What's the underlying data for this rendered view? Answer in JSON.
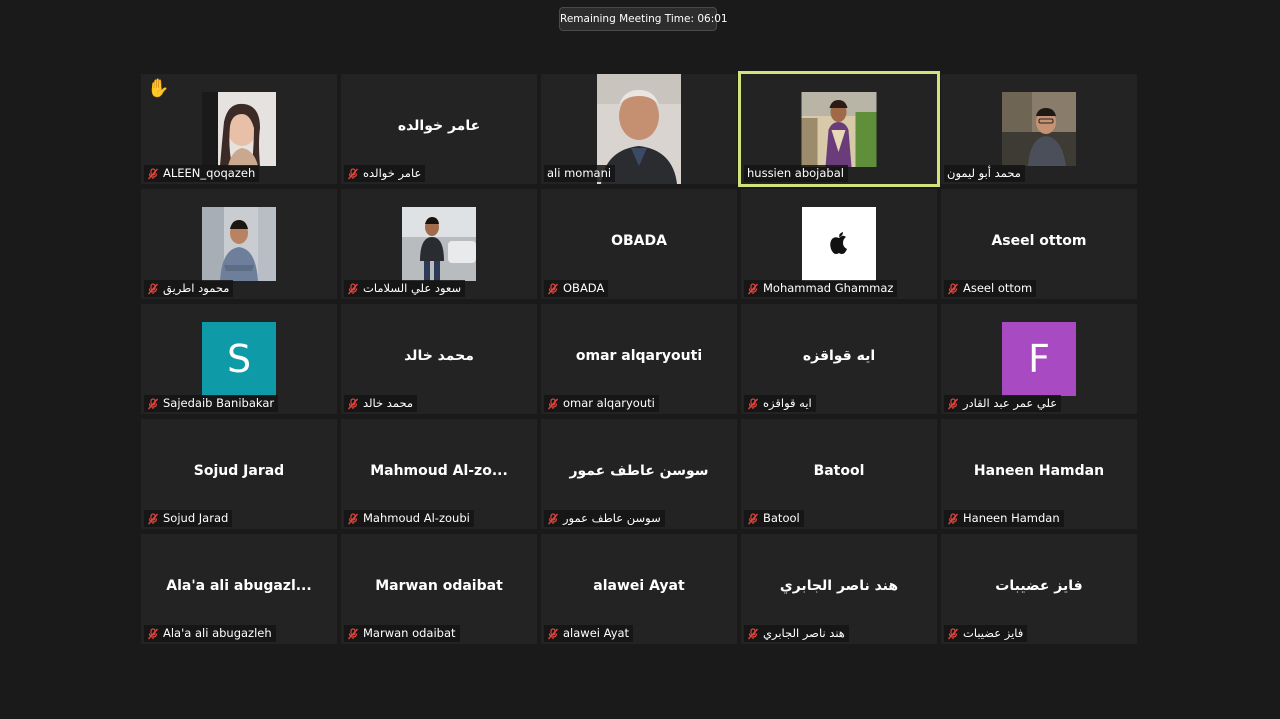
{
  "meeting": {
    "remaining_time_label": "Remaining Meeting Time: 06:01"
  },
  "colors": {
    "background": "#1a1a1a",
    "tile": "#232323",
    "active_speaker_border": "#d1e37a",
    "muted_icon": "#e0453c"
  },
  "participants": [
    {
      "label": "ALEEN_qoqazeh",
      "muted": true,
      "raised_hand": true,
      "media": "photo"
    },
    {
      "label": "عامر خوالده",
      "display": "عامر خوالده",
      "muted": true,
      "media": "name"
    },
    {
      "label": "ali momani",
      "muted": false,
      "media": "video"
    },
    {
      "label": "hussien abojabal",
      "muted": false,
      "media": "photo",
      "active_speaker": true
    },
    {
      "label": "محمد أبو ليمون",
      "muted": false,
      "media": "photo"
    },
    {
      "label": "محمود اطريق",
      "muted": true,
      "media": "photo"
    },
    {
      "label": "سعود علي السلامات",
      "muted": true,
      "media": "photo"
    },
    {
      "label": "OBADA",
      "display": "OBADA",
      "muted": true,
      "media": "name"
    },
    {
      "label": "Mohammad Ghammaz",
      "muted": true,
      "media": "apple-logo"
    },
    {
      "label": "Aseel ottom",
      "display": "Aseel ottom",
      "muted": true,
      "media": "name"
    },
    {
      "label": "Sajedaib Banibakar",
      "muted": true,
      "media": "letter",
      "letter": "S",
      "letter_color": "#0e9aa7"
    },
    {
      "label": "محمد خالد",
      "display": "محمد خالد",
      "muted": true,
      "media": "name"
    },
    {
      "label": "omar alqaryouti",
      "display": "omar alqaryouti",
      "muted": true,
      "media": "name"
    },
    {
      "label": "ايه قواقزه",
      "display": "ايه قواقزه",
      "muted": true,
      "media": "name"
    },
    {
      "label": "علي عمر عبد القادر",
      "muted": true,
      "media": "letter",
      "letter": "F",
      "letter_color": "#a84bc2"
    },
    {
      "label": "Sojud Jarad",
      "display": "Sojud Jarad",
      "muted": true,
      "media": "name"
    },
    {
      "label": "Mahmoud Al-zoubi",
      "display": "Mahmoud  Al-zo...",
      "muted": true,
      "media": "name"
    },
    {
      "label": "سوسن عاطف عمور",
      "display": "سوسن عاطف عمور",
      "muted": true,
      "media": "name"
    },
    {
      "label": "Batool",
      "display": "Batool",
      "muted": true,
      "media": "name"
    },
    {
      "label": "Haneen Hamdan",
      "display": "Haneen Hamdan",
      "muted": true,
      "media": "name"
    },
    {
      "label": "Ala'a ali abugazleh",
      "display": "Ala'a  ali  abugazl...",
      "muted": true,
      "media": "name"
    },
    {
      "label": "Marwan odaibat",
      "display": "Marwan odaibat",
      "muted": true,
      "media": "name"
    },
    {
      "label": "alawei Ayat",
      "display": "alawei  Ayat",
      "muted": true,
      "media": "name"
    },
    {
      "label": "هند ناصر الجابري",
      "display": "هند ناصر الجابري",
      "muted": true,
      "media": "name"
    },
    {
      "label": "فايز عضيبات",
      "display": "فايز عضيبات",
      "muted": true,
      "media": "name"
    }
  ]
}
